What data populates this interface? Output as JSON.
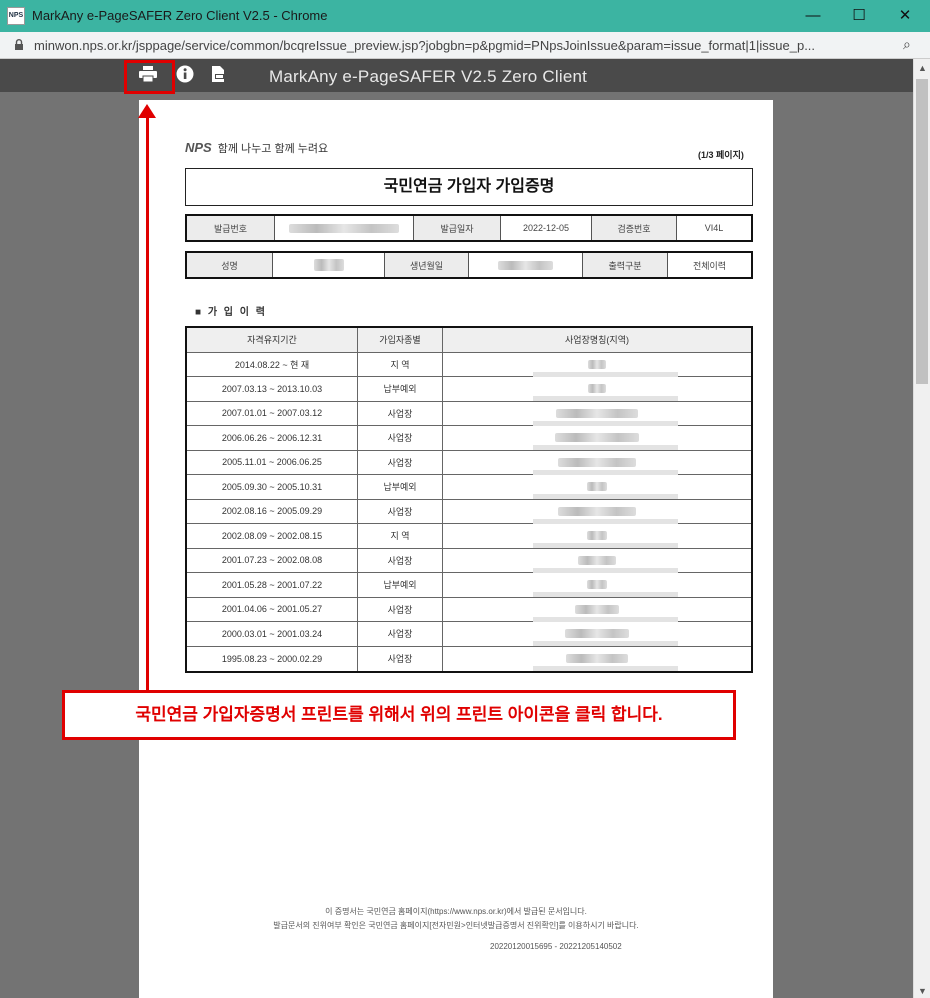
{
  "window": {
    "app_icon_text": "NPS",
    "title": "MarkAny e-PageSAFER Zero Client V2.5 - Chrome",
    "min": "—",
    "max": "☐",
    "close": "✕"
  },
  "address": {
    "url": "minwon.nps.or.kr/jsppage/service/common/bcqreIssue_preview.jsp?jobgbn=p&pgmid=PNpsJoinIssue&param=issue_format|1|issue_p...",
    "zoom_icon": "⌕"
  },
  "viewer": {
    "title": "MarkAny e-PageSAFER V2.5 Zero Client",
    "print_icon": "printer-icon",
    "info_icon": "info-icon",
    "export_icon": "export-icon"
  },
  "document": {
    "logo_mark": "NPS",
    "logo_slogan": "함께 나누고 함께 누려요",
    "page_indicator": "(1/3 페이지)",
    "title": "국민연금 가입자 가입증명",
    "row1": {
      "issue_no_label": "발급번호",
      "issue_date_label": "발급일자",
      "issue_date": "2022-12-05",
      "verify_label": "검증번호",
      "verify_code": "VI4L"
    },
    "row2": {
      "name_label": "성명",
      "birth_label": "생년월일",
      "output_label": "출력구분",
      "output_value": "전체이력"
    },
    "section_label": "■ 가 입 이 력",
    "history_headers": [
      "자격유지기간",
      "가입자종별",
      "사업장명칭(지역)"
    ],
    "history_rows": [
      {
        "period": "2014.08.22 ~ 현 재",
        "type": "지 역"
      },
      {
        "period": "2007.03.13 ~ 2013.10.03",
        "type": "납부예외"
      },
      {
        "period": "2007.01.01 ~ 2007.03.12",
        "type": "사업장"
      },
      {
        "period": "2006.06.26 ~ 2006.12.31",
        "type": "사업장"
      },
      {
        "period": "2005.11.01 ~ 2006.06.25",
        "type": "사업장"
      },
      {
        "period": "2005.09.30 ~ 2005.10.31",
        "type": "납부예외"
      },
      {
        "period": "2002.08.16 ~ 2005.09.29",
        "type": "사업장"
      },
      {
        "period": "2002.08.09 ~ 2002.08.15",
        "type": "지 역"
      },
      {
        "period": "2001.07.23 ~ 2002.08.08",
        "type": "사업장"
      },
      {
        "period": "2001.05.28 ~ 2001.07.22",
        "type": "납부예외"
      },
      {
        "period": "2001.04.06 ~ 2001.05.27",
        "type": "사업장"
      },
      {
        "period": "2000.03.01 ~ 2001.03.24",
        "type": "사업장"
      },
      {
        "period": "1995.08.23 ~ 2000.02.29",
        "type": "사업장"
      }
    ],
    "footer_line1": "이 증명서는 국민연금 홈페이지(https://www.nps.or.kr)에서 발급된 문서입니다.",
    "footer_line2": "발급문서의 진위여부 확인은 국민연금 홈페이지[전자민원>인터넷발급증명서 진위확인]를 이용하시기 바랍니다.",
    "serial": "20220120015695 - 20221205140502"
  },
  "annotation": {
    "callout_text": "국민연금 가입자증명서 프린트를 위해서 위의 프린트 아이콘을 클릭 합니다.",
    "color": "#e00000"
  },
  "colors": {
    "titlebar": "#3cb4a2",
    "toolbar": "#4a4a4a",
    "viewport": "#737373"
  }
}
